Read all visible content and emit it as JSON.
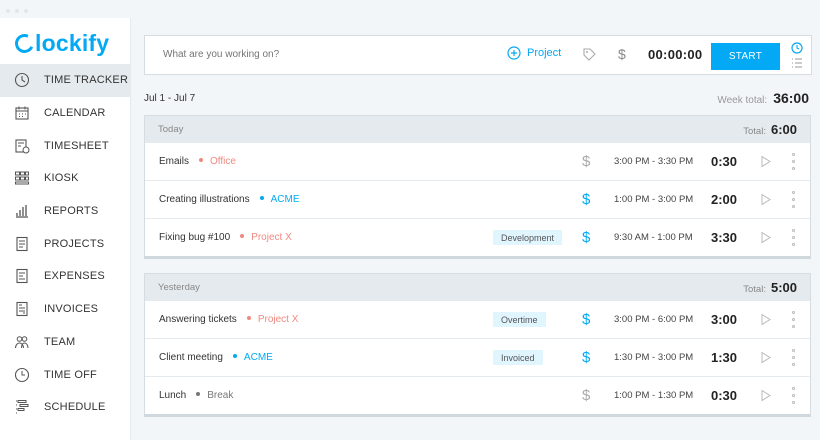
{
  "app": {
    "logo": "Clockify",
    "logo_rest": "lockify"
  },
  "sidebar": {
    "items": [
      {
        "label": "TIME TRACKER",
        "icon": "clock-icon",
        "active": true
      },
      {
        "label": "CALENDAR",
        "icon": "calendar-icon"
      },
      {
        "label": "TIMESHEET",
        "icon": "timesheet-icon"
      },
      {
        "label": "KIOSK",
        "icon": "kiosk-icon"
      },
      {
        "label": "REPORTS",
        "icon": "reports-icon"
      },
      {
        "label": "PROJECTS",
        "icon": "projects-icon"
      },
      {
        "label": "EXPENSES",
        "icon": "expenses-icon"
      },
      {
        "label": "INVOICES",
        "icon": "invoices-icon"
      },
      {
        "label": "TEAM",
        "icon": "team-icon"
      },
      {
        "label": "TIME OFF",
        "icon": "time-off-icon"
      },
      {
        "label": "SCHEDULE",
        "icon": "schedule-icon"
      }
    ]
  },
  "timer": {
    "placeholder": "What are you working on?",
    "project_label": "Project",
    "time": "00:00:00",
    "start_label": "START",
    "accent": "#03a9f4"
  },
  "week": {
    "range": "Jul 1 - Jul 7",
    "total_label": "Week total:",
    "total": "36:00"
  },
  "groups": [
    {
      "label": "Today",
      "total_label": "Total:",
      "total": "6:00",
      "entries": [
        {
          "description": "Emails",
          "project": "Office",
          "project_color": "#ef8a80",
          "tag": "",
          "billable": false,
          "times": "3:00 PM - 3:30 PM",
          "duration": "0:30"
        },
        {
          "description": "Creating illustrations",
          "project": "ACME",
          "project_color": "#03a9f4",
          "tag": "",
          "billable": true,
          "times": "1:00 PM - 3:00 PM",
          "duration": "2:00"
        },
        {
          "description": "Fixing bug #100",
          "project": "Project X",
          "project_color": "#ef8a80",
          "tag": "Development",
          "billable": true,
          "times": "9:30 AM - 1:00 PM",
          "duration": "3:30"
        }
      ]
    },
    {
      "label": "Yesterday",
      "total_label": "Total:",
      "total": "5:00",
      "entries": [
        {
          "description": "Answering tickets",
          "project": "Project X",
          "project_color": "#ef8a80",
          "tag": "Overtime",
          "billable": true,
          "times": "3:00 PM - 6:00 PM",
          "duration": "3:00"
        },
        {
          "description": "Client meeting",
          "project": "ACME",
          "project_color": "#03a9f4",
          "tag": "Invoiced",
          "billable": true,
          "times": "1:30 PM - 3:00 PM",
          "duration": "1:30"
        },
        {
          "description": "Lunch",
          "project": "Break",
          "project_color": "#777777",
          "tag": "",
          "billable": false,
          "times": "1:00 PM - 1:30 PM",
          "duration": "0:30"
        }
      ]
    }
  ]
}
